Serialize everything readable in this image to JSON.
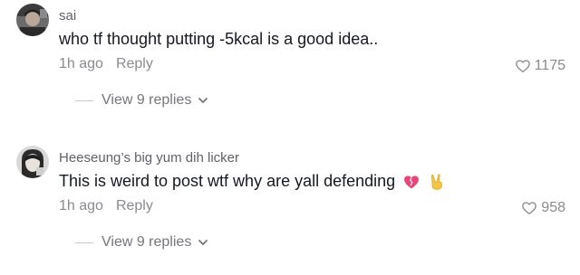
{
  "comments": [
    {
      "username": "sai",
      "text": "who tf thought putting -5kcal is a good idea..",
      "time": "1h ago",
      "reply_label": "Reply",
      "likes": "1175",
      "view_replies": "View 9 replies",
      "avatar_icon": "user-avatar-icon"
    },
    {
      "username": "Heeseung’s big yum dih licker",
      "text": "This is weird to post wtf why are yall defending",
      "emojis": [
        "broken-heart-icon",
        "victory-hand-icon"
      ],
      "time": "1h ago",
      "reply_label": "Reply",
      "likes": "958",
      "view_replies": "View 9 replies",
      "avatar_icon": "user-avatar-icon"
    }
  ],
  "colors": {
    "username": "#5f616a",
    "text": "#161823",
    "meta": "#8a8b91",
    "broken_heart": "#e8457a",
    "victory_hand": "#f5c542"
  }
}
